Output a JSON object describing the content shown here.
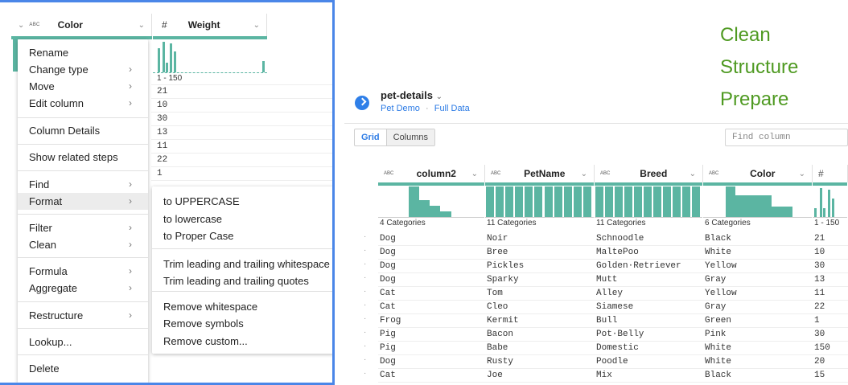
{
  "left_panel": {
    "columns": [
      {
        "type_icon": "ABC",
        "title": "Color"
      },
      {
        "type_icon": "#",
        "title": "Weight"
      }
    ],
    "weight_range": "1 - 150",
    "weight_values": [
      "21",
      "10",
      "30",
      "13",
      "11",
      "22",
      "1"
    ],
    "weight_histogram": [
      0.75,
      0.95,
      0.3,
      0.9,
      0.65,
      0.35
    ],
    "menu": {
      "items": [
        {
          "label": "Rename",
          "submenu": false
        },
        {
          "label": "Change type",
          "submenu": true
        },
        {
          "label": "Move",
          "submenu": true
        },
        {
          "label": "Edit column",
          "submenu": true
        },
        {
          "label": "Column Details",
          "submenu": false
        },
        {
          "label": "Show related steps",
          "submenu": false
        },
        {
          "label": "Find",
          "submenu": true
        },
        {
          "label": "Format",
          "submenu": true,
          "active": true
        },
        {
          "label": "Filter",
          "submenu": true
        },
        {
          "label": "Clean",
          "submenu": true
        },
        {
          "label": "Formula",
          "submenu": true
        },
        {
          "label": "Aggregate",
          "submenu": true
        },
        {
          "label": "Restructure",
          "submenu": true
        },
        {
          "label": "Lookup...",
          "submenu": false
        },
        {
          "label": "Delete",
          "submenu": false
        }
      ]
    },
    "format_submenu": {
      "items": [
        "to UPPERCASE",
        "to lowercase",
        "to Proper Case",
        "Trim leading and trailing whitespace",
        "Trim leading and trailing quotes",
        "Remove whitespace",
        "Remove symbols",
        "Remove custom..."
      ]
    }
  },
  "taglines": [
    "Clean",
    "Structure",
    "Prepare"
  ],
  "dataset": {
    "name": "pet-details",
    "flow": "Pet Demo",
    "separator": "·",
    "sample": "Full Data",
    "view_tabs": [
      "Grid",
      "Columns"
    ],
    "find_placeholder": "Find column"
  },
  "grid": {
    "columns": [
      {
        "type_icon": "ABC",
        "name": "column2",
        "summary": "4 Categories",
        "histogram": [
          1.0,
          0.55,
          0.38,
          0.18
        ]
      },
      {
        "type_icon": "ABC",
        "name": "PetName",
        "summary": "11 Categories",
        "histogram": [
          1,
          1,
          1,
          1,
          1,
          1,
          1,
          1,
          1,
          1,
          1
        ]
      },
      {
        "type_icon": "ABC",
        "name": "Breed",
        "summary": "11 Categories",
        "histogram": [
          1,
          1,
          1,
          1,
          1,
          1,
          1,
          1,
          1,
          1,
          1
        ]
      },
      {
        "type_icon": "ABC",
        "name": "Color",
        "summary": "6 Categories",
        "histogram": [
          1.0,
          0.7,
          0.7,
          0.7,
          0.35,
          0.35
        ]
      },
      {
        "type_icon": "#",
        "name": "",
        "summary": "1 - 150",
        "histogram": [
          0.3,
          0.95,
          0.3,
          0.9,
          0.6
        ]
      }
    ],
    "rows": [
      [
        "Dog",
        "Noir",
        "Schnoodle",
        "Black",
        "21"
      ],
      [
        "Dog",
        "Bree",
        "MaltePoo",
        "White",
        "10"
      ],
      [
        "Dog",
        "Pickles",
        "Golden·Retriever",
        "Yellow",
        "30"
      ],
      [
        "Dog",
        "Sparky",
        "Mutt",
        "Gray",
        "13"
      ],
      [
        "Cat",
        "Tom",
        "Alley",
        "Yellow",
        "11"
      ],
      [
        "Cat",
        "Cleo",
        "Siamese",
        "Gray",
        "22"
      ],
      [
        "Frog",
        "Kermit",
        "Bull",
        "Green",
        "1"
      ],
      [
        "Pig",
        "Bacon",
        "Pot·Belly",
        "Pink",
        "30"
      ],
      [
        "Pig",
        "Babe",
        "Domestic",
        "White",
        "150"
      ],
      [
        "Dog",
        "Rusty",
        "Poodle",
        "White",
        "20"
      ],
      [
        "Cat",
        "Joe",
        "Mix",
        "Black",
        "15"
      ]
    ],
    "row_marker": "·"
  }
}
